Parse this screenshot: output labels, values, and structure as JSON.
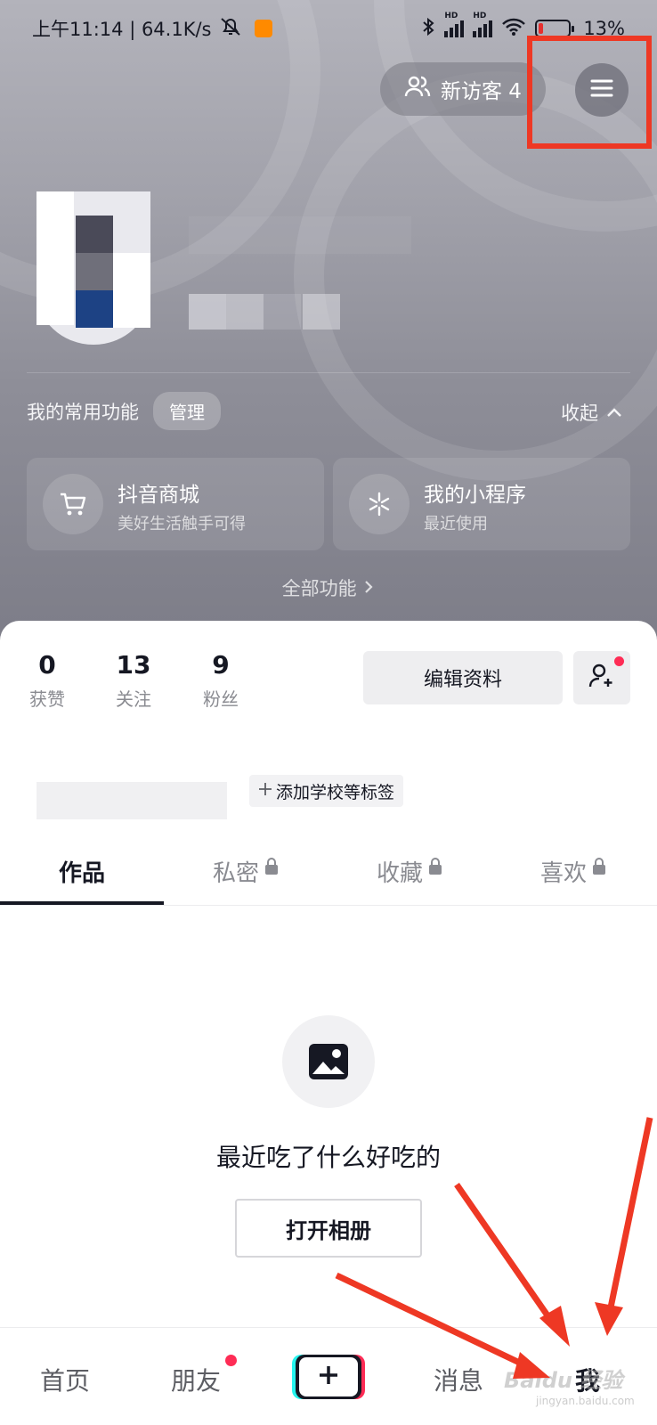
{
  "status_bar": {
    "time_speed": "上午11:14 | 64.1K/s",
    "hd1": "HD",
    "hd2": "HD",
    "battery": "13%"
  },
  "header": {
    "visitor_label": "新访客 4"
  },
  "common_functions": {
    "title": "我的常用功能",
    "manage": "管理",
    "collapse": "收起",
    "cards": [
      {
        "name": "抖音商城",
        "sub": "美好生活触手可得",
        "icon": "cart-icon"
      },
      {
        "name": "我的小程序",
        "sub": "最近使用",
        "icon": "mini-program-icon"
      }
    ],
    "all_functions": "全部功能"
  },
  "stats": [
    {
      "value": "0",
      "label": "获赞"
    },
    {
      "value": "13",
      "label": "关注"
    },
    {
      "value": "9",
      "label": "粉丝"
    }
  ],
  "actions": {
    "edit_profile": "编辑资料",
    "add_school_tag": "添加学校等标签"
  },
  "tabs": [
    {
      "label": "作品",
      "locked": false
    },
    {
      "label": "私密",
      "locked": true
    },
    {
      "label": "收藏",
      "locked": true
    },
    {
      "label": "喜欢",
      "locked": true
    }
  ],
  "empty_state": {
    "text": "最近吃了什么好吃的",
    "button": "打开相册"
  },
  "bottom_nav": {
    "home": "首页",
    "friends": "朋友",
    "messages": "消息",
    "me": "我"
  },
  "watermark": {
    "brand": "Baidu 经验",
    "site": "jingyan.baidu.com"
  },
  "colors": {
    "accent_red": "#fe2c55",
    "annotation_red": "#ee3824",
    "tiktok_cyan": "#25f4ee"
  }
}
